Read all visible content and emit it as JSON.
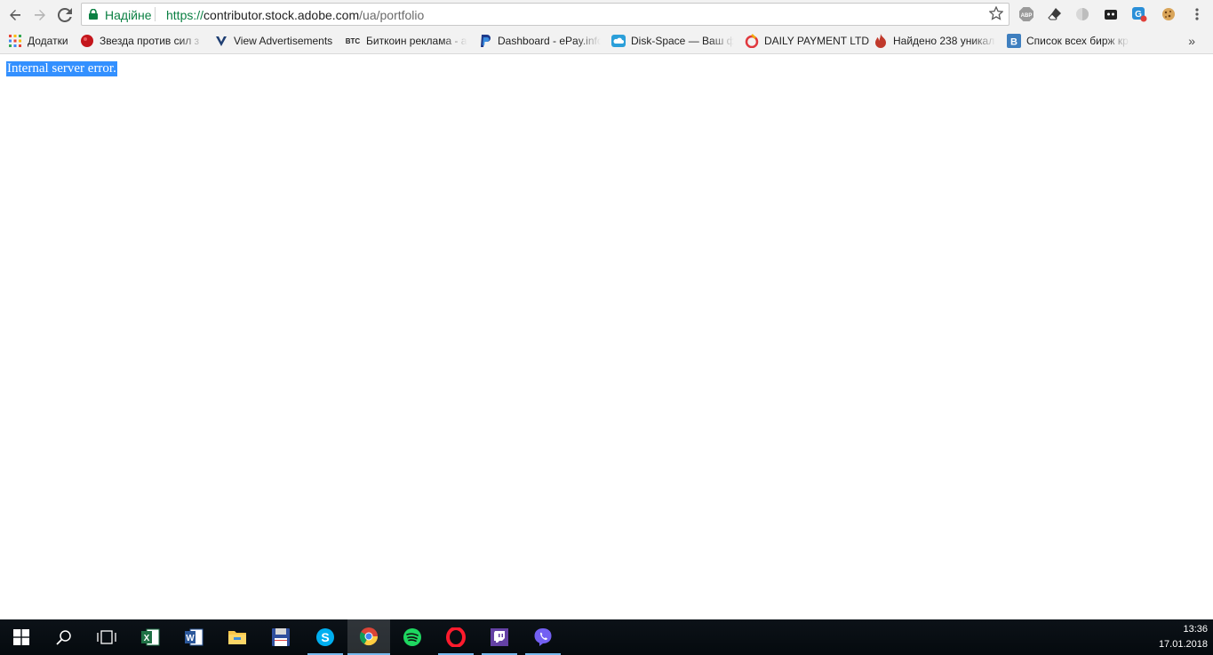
{
  "browser": {
    "security_label": "Надійне",
    "url": {
      "scheme": "https://",
      "host": "contributor.stock.adobe.com",
      "path": "/ua/portfolio"
    },
    "extensions": [
      "abp-icon",
      "eraser-icon",
      "circle-extension-icon",
      "cat-extension-icon",
      "shield-extension-icon",
      "cookie-icon",
      "menu-icon"
    ]
  },
  "bookmarks": {
    "apps_label": "Додатки",
    "items": [
      {
        "label": "Звезда против сил з",
        "icon": "red-ball-icon"
      },
      {
        "label": "View Advertisements",
        "icon": "v-logo-icon"
      },
      {
        "label": "Биткоин реклама - а",
        "icon": "btc-icon"
      },
      {
        "label": "Dashboard - ePay.info",
        "icon": "paypal-icon"
      },
      {
        "label": "Disk-Space — Ваш ф",
        "icon": "cloud-icon"
      },
      {
        "label": "DAILY PAYMENT LTD",
        "icon": "chart-logo-icon"
      },
      {
        "label": "Найдено 238 уникал",
        "icon": "flame-icon"
      },
      {
        "label": "Список всех бирж кр",
        "icon": "b-logo-icon"
      }
    ],
    "more": "»"
  },
  "page": {
    "error_text": "Internal server error."
  },
  "taskbar": {
    "time": "13:36",
    "date": "17.01.2018",
    "apps": [
      "start-icon",
      "search-icon",
      "task-view-icon",
      "excel-icon",
      "word-icon",
      "file-explorer-icon",
      "floppy-app-icon",
      "skype-icon",
      "chrome-icon",
      "spotify-icon",
      "opera-icon",
      "twitch-icon",
      "viber-icon"
    ]
  }
}
